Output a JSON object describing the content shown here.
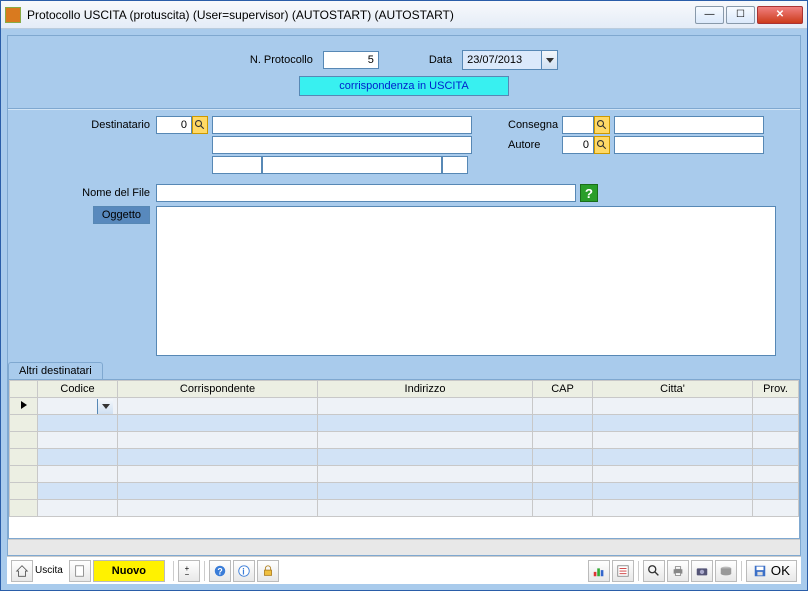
{
  "title": "Protocollo USCITA   (protuscita)   (User=supervisor) (AUTOSTART) (AUTOSTART)",
  "header": {
    "n_protocollo_label": "N. Protocollo",
    "n_protocollo_value": "5",
    "data_label": "Data",
    "data_value": "23/07/2013",
    "banner": "corrispondenza in USCITA"
  },
  "form": {
    "destinatario_label": "Destinatario",
    "destinatario_code": "0",
    "destinatario_name": "",
    "destinatario_addr": "",
    "destinatario_cap": "",
    "destinatario_city": "",
    "destinatario_prov": "",
    "consegna_label": "Consegna",
    "consegna_code": "",
    "consegna_name": "",
    "autore_label": "Autore",
    "autore_code": "0",
    "autore_name": "",
    "nome_file_label": "Nome del File",
    "nome_file_value": "",
    "oggetto_label": "Oggetto",
    "oggetto_value": ""
  },
  "tabs": {
    "altri_destinatari": "Altri destinatari"
  },
  "grid": {
    "columns": [
      "",
      "Codice",
      "Corrispondente",
      "Indirizzo",
      "CAP",
      "Citta'",
      "Prov."
    ]
  },
  "toolbar": {
    "uscita": "Uscita",
    "nuovo": "Nuovo",
    "ok": "OK"
  }
}
